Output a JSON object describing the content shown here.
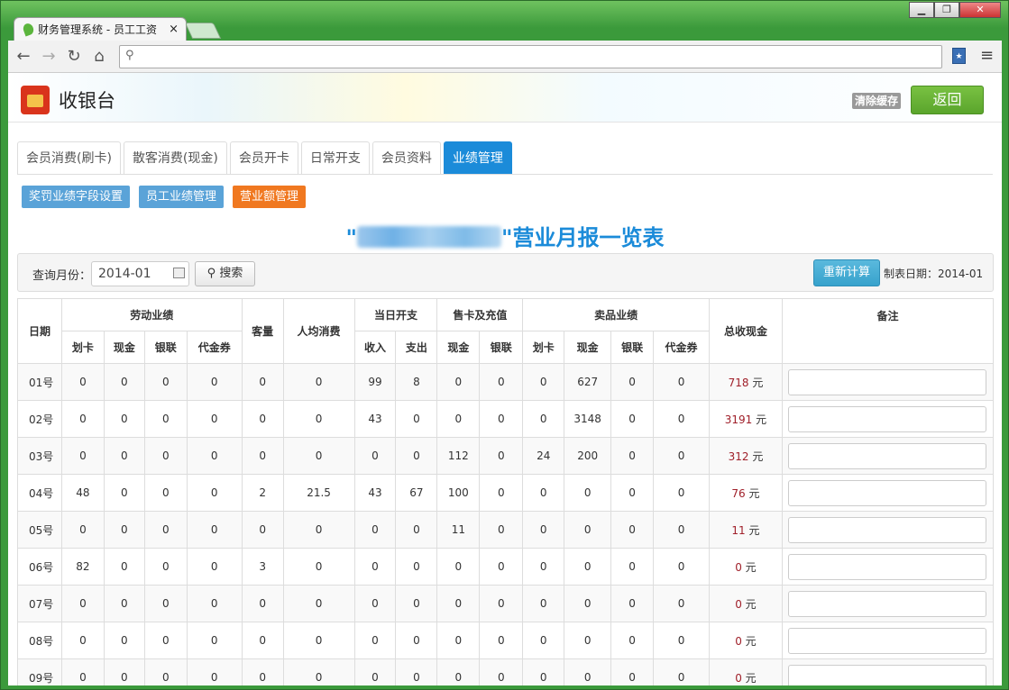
{
  "browser": {
    "tab_title": "财务管理系统 - 员工工资",
    "close_glyph": "×",
    "window_controls": [
      "▁",
      "❐",
      "✕"
    ]
  },
  "header": {
    "title": "收银台",
    "clear_cache": "清除缓存",
    "back": "返回"
  },
  "tabs": [
    "会员消费(刷卡)",
    "散客消费(现金)",
    "会员开卡",
    "日常开支",
    "会员资料",
    "业绩管理"
  ],
  "sub_buttons": [
    "奖罚业绩字段设置",
    "员工业绩管理",
    "营业额管理"
  ],
  "report": {
    "title_prefix": "\"",
    "title_suffix": "\"营业月报一览表"
  },
  "search": {
    "label": "查询月份：",
    "month_value": "2014-01",
    "search_button": "搜索",
    "recalc_button": "重新计算",
    "make_date": "制表日期：2014-01"
  },
  "table": {
    "group_headers": [
      "日期",
      "劳动业绩",
      "客量",
      "人均消费",
      "当日开支",
      "售卡及充值",
      "卖品业绩",
      "总收现金",
      "备注"
    ],
    "sub_headers": [
      "划卡",
      "现金",
      "银联",
      "代金券",
      "收入",
      "支出",
      "现金",
      "银联",
      "划卡",
      "现金",
      "银联",
      "代金券"
    ],
    "unit": "元",
    "rows": [
      [
        "01号",
        "0",
        "0",
        "0",
        "0",
        "0",
        "0",
        "99",
        "8",
        "0",
        "0",
        "0",
        "627",
        "0",
        "0",
        "718"
      ],
      [
        "02号",
        "0",
        "0",
        "0",
        "0",
        "0",
        "0",
        "43",
        "0",
        "0",
        "0",
        "0",
        "3148",
        "0",
        "0",
        "3191"
      ],
      [
        "03号",
        "0",
        "0",
        "0",
        "0",
        "0",
        "0",
        "0",
        "0",
        "112",
        "0",
        "24",
        "200",
        "0",
        "0",
        "312"
      ],
      [
        "04号",
        "48",
        "0",
        "0",
        "0",
        "2",
        "21.5",
        "43",
        "67",
        "100",
        "0",
        "0",
        "0",
        "0",
        "0",
        "76"
      ],
      [
        "05号",
        "0",
        "0",
        "0",
        "0",
        "0",
        "0",
        "0",
        "0",
        "11",
        "0",
        "0",
        "0",
        "0",
        "0",
        "11"
      ],
      [
        "06号",
        "82",
        "0",
        "0",
        "0",
        "3",
        "0",
        "0",
        "0",
        "0",
        "0",
        "0",
        "0",
        "0",
        "0",
        "0"
      ],
      [
        "07号",
        "0",
        "0",
        "0",
        "0",
        "0",
        "0",
        "0",
        "0",
        "0",
        "0",
        "0",
        "0",
        "0",
        "0",
        "0"
      ],
      [
        "08号",
        "0",
        "0",
        "0",
        "0",
        "0",
        "0",
        "0",
        "0",
        "0",
        "0",
        "0",
        "0",
        "0",
        "0",
        "0"
      ],
      [
        "09号",
        "0",
        "0",
        "0",
        "0",
        "0",
        "0",
        "0",
        "0",
        "0",
        "0",
        "0",
        "0",
        "0",
        "0",
        "0"
      ]
    ]
  },
  "colors": {
    "accent": "#1b8bd9",
    "orange": "#f07820",
    "green": "#5aa52c",
    "total_red": "#a0202a"
  }
}
